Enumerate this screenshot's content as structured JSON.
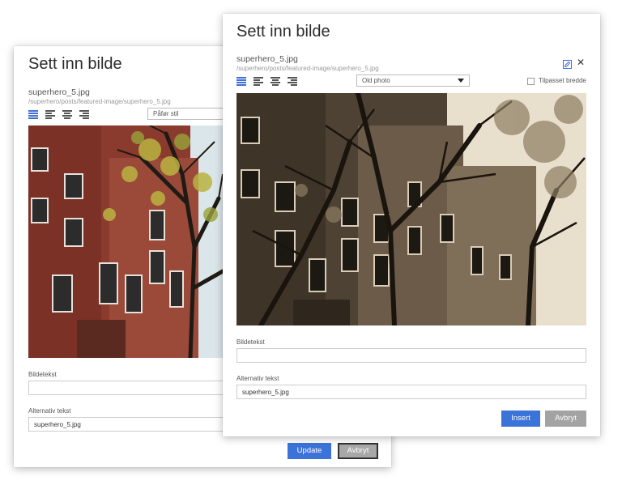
{
  "back_dialog": {
    "title": "Sett inn bilde",
    "filename": "superhero_5.jpg",
    "filepath": "/superhero/posts/featured-image/superhero_5.jpg",
    "style_select": "Påfør stil",
    "caption_label": "Bildetekst",
    "caption_value": "",
    "alt_label": "Alternativ tekst",
    "alt_value": "superhero_5.jpg",
    "update_label": "Update",
    "cancel_label": "Avbryt"
  },
  "front_dialog": {
    "title": "Sett inn bilde",
    "filename": "superhero_5.jpg",
    "filepath": "/superhero/posts/featured-image/superhero_5.jpg",
    "style_select": "Old photo",
    "fit_width_label": "Tilpasset bredde",
    "fit_width_checked": false,
    "caption_label": "Bildetekst",
    "caption_value": "",
    "alt_label": "Alternativ tekst",
    "alt_value": "superhero_5.jpg",
    "insert_label": "Insert",
    "cancel_label": "Avbryt"
  },
  "icons": {
    "edit": "edit-image-icon",
    "close": "close-icon",
    "align": [
      "align-left-icon",
      "align-center-icon",
      "align-right-icon",
      "align-justify-icon"
    ]
  },
  "colors": {
    "primary": "#3b73d9",
    "secondary": "#a3a3a3",
    "active_align": "#3f6fd8"
  }
}
